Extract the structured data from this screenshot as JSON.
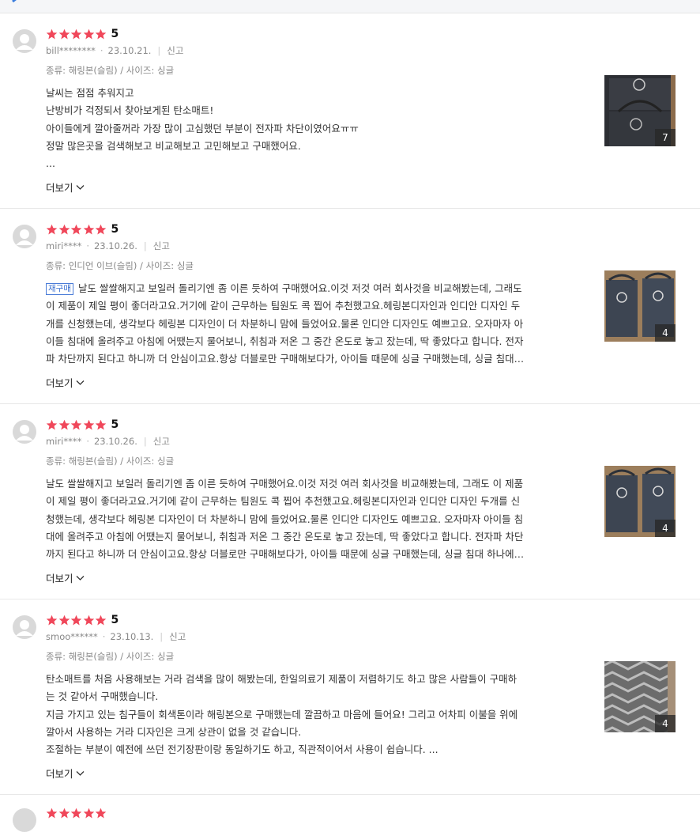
{
  "colors": {
    "star": "#f0475a",
    "tag_border": "#4a7cd8"
  },
  "reviews": [
    {
      "score": "5",
      "user": "bill********",
      "date": "23.10.21.",
      "report": "신고",
      "kind": "종류: 해링본(슬림) / 사이즈: 싱글",
      "tag": "",
      "lines": [
        "날씨는 점점 추워지고",
        "난방비가 걱정되서 찾아보게된 탄소매트!",
        "아이들에게 깔아줄꺼라 가장 많이 고심했던 부분이 전자파 차단이였어요ㅠㅠ",
        "정말 많은곳을 검색해보고 비교해보고 고민해보고 구매했어요.",
        "..."
      ],
      "more": "더보기",
      "photo_count": "7"
    },
    {
      "score": "5",
      "user": "miri****",
      "date": "23.10.26.",
      "report": "신고",
      "kind": "종류: 인디언 이브(슬림) / 사이즈: 싱글",
      "tag": "재구매",
      "lines": [
        "날도 쌀쌀해지고 보일러 돌리기엔 좀 이른 듯하여 구매했어요.이것 저것 여러 회사것을 비교해봤는데, 그래도",
        "이 제품이 제일 평이 좋더라고요.거기에 같이 근무하는 팀원도 콕 찝어 추천했고요.헤링본디자인과 인디안 디자인 두",
        "개를 신청했는데, 생각보다 헤링본 디자인이 더 차분하니 맘에 들었어요.물론 인디안 디자인도 예쁘고요. 오자마자 아",
        "이들 침대에 올려주고 아침에 어땠는지 물어보니, 취침과 저온 그 중간 온도로 놓고 잤는데, 딱 좋았다고 합니다. 전자",
        "파 차단까지 된다고 하니까 더 안심이고요.항상 더블로만 구매해보다가, 아이들 때문에 싱글 구매했는데, 싱글 침대…"
      ],
      "more": "더보기",
      "photo_count": "4"
    },
    {
      "score": "5",
      "user": "miri****",
      "date": "23.10.26.",
      "report": "신고",
      "kind": "종류: 해링본(슬림) / 사이즈: 싱글",
      "tag": "",
      "lines": [
        "날도 쌀쌀해지고 보일러 돌리기엔 좀 이른 듯하여 구매했어요.이것 저것 여러 회사것을 비교해봤는데, 그래도 이 제품",
        "이 제일 평이 좋더라고요.거기에 같이 근무하는 팀원도 콕 찝어 추천했고요.헤링본디자인과 인디안 디자인 두개를 신",
        "청했는데, 생각보다 헤링본 디자인이 더 차분하니 맘에 들었어요.물론 인디안 디자인도 예쁘고요. 오자마자 아이들 침",
        "대에 올려주고 아침에 어땠는지 물어보니, 취침과 저온 그 중간 온도로 놓고 잤는데, 딱 좋았다고 합니다. 전자파 차단",
        "까지 된다고 하니까 더 안심이고요.항상 더블로만 구매해보다가, 아이들 때문에 싱글 구매했는데, 싱글 침대 하나에…"
      ],
      "more": "더보기",
      "photo_count": "4"
    },
    {
      "score": "5",
      "user": "smoo******",
      "date": "23.10.13.",
      "report": "신고",
      "kind": "종류: 해링본(슬림) / 사이즈: 싱글",
      "tag": "",
      "lines": [
        "탄소매트를 처음 사용해보는 거라 검색을 많이 해봤는데, 한일의료기 제품이 저렴하기도 하고 많은 사람들이 구매하",
        "는 것 같아서 구매했습니다.",
        "지금 가지고 있는 침구들이 회색톤이라 해링본으로 구매했는데 깔끔하고 마음에 들어요! 그리고 어차피 이불을 위에",
        "깔아서 사용하는 거라 디자인은 크게 상관이 없을 것 같습니다.",
        "조절하는 부분이 예전에 쓰던 전기장판이랑 동일하기도 하고, 직관적이어서 사용이 쉽습니다. ..."
      ],
      "more": "더보기",
      "photo_count": "4"
    }
  ]
}
